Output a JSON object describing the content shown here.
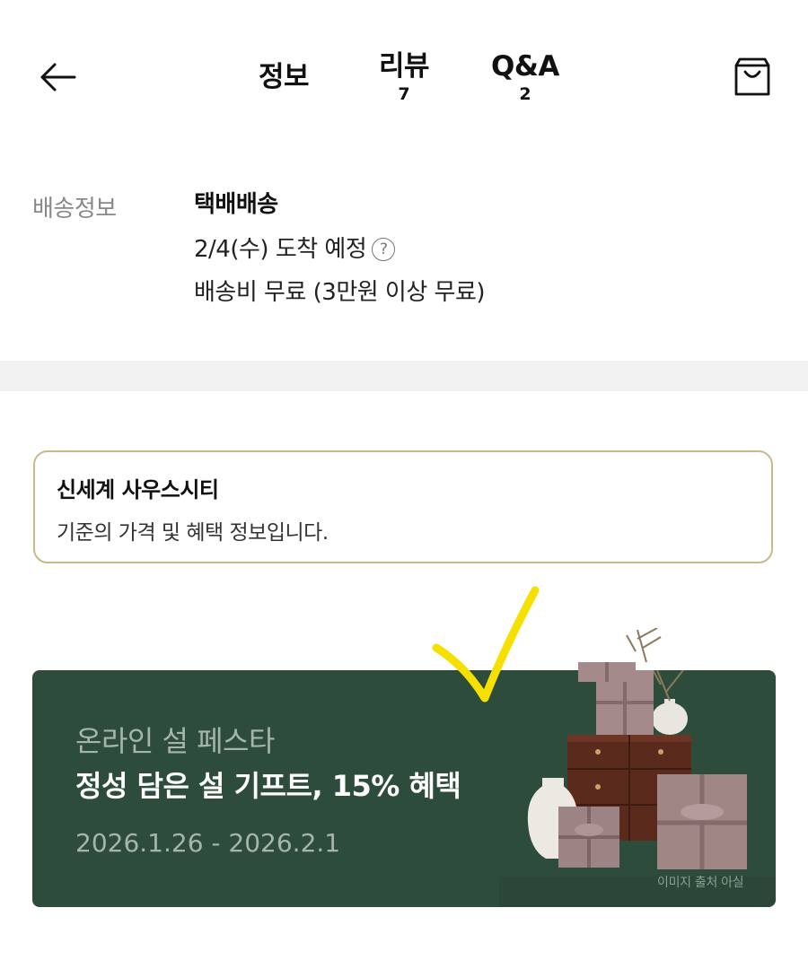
{
  "header": {
    "back_icon": "arrow-left-icon",
    "cart_icon": "shopping-bag-icon",
    "tabs": [
      {
        "label": "정보",
        "count": ""
      },
      {
        "label": "리뷰",
        "count": "7"
      },
      {
        "label": "Q&A",
        "count": "2"
      }
    ]
  },
  "shipping": {
    "label": "배송정보",
    "method": "택배배송",
    "arrival": "2/4(수) 도착 예정",
    "fee": "배송비 무료 (3만원 이상 무료)",
    "help_symbol": "?"
  },
  "notice": {
    "title": "신세계 사우스시티",
    "description": "기준의 가격 및 혜택 정보입니다."
  },
  "banner": {
    "subtitle": "온라인 설 페스타",
    "title": "정성 담은 설 기프트, 15% 혜택",
    "date": "2026.1.26 - 2026.2.1",
    "credit": "이미지 출처 아실"
  },
  "colors": {
    "banner_bg": "#2d4c3c",
    "notice_border": "#c9b98a",
    "check_mark": "#f5e000"
  }
}
